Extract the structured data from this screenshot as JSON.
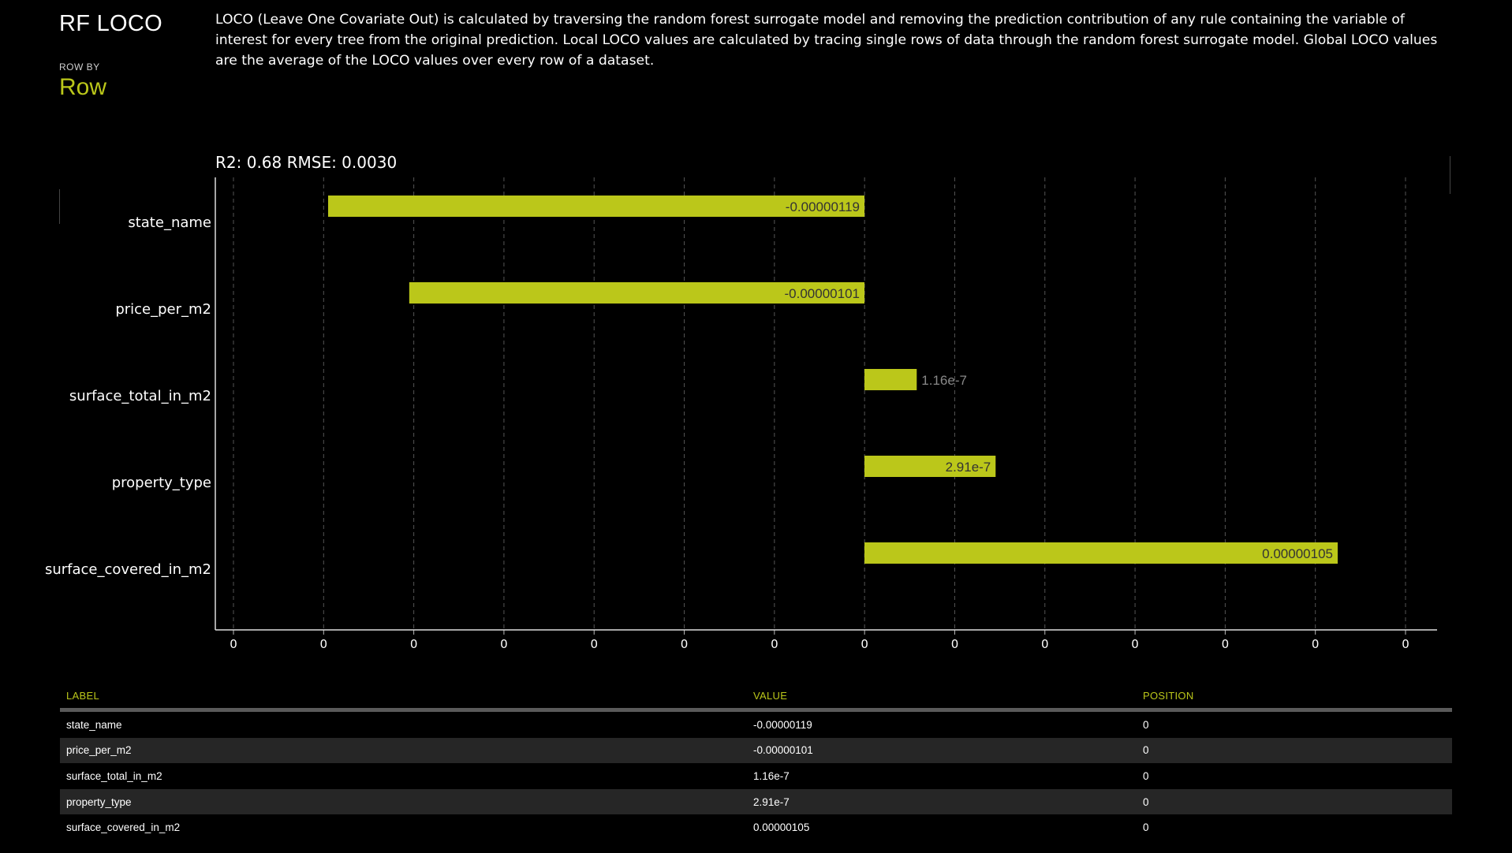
{
  "header": {
    "title": "RF LOCO",
    "row_by_label": "ROW BY",
    "row_by_value": "Row",
    "description": "LOCO (Leave One Covariate Out) is calculated by traversing the random forest surrogate model and removing the prediction contribution of any rule containing the variable of interest for every tree from the original prediction. Local LOCO values are calculated by tracing single rows of data through the random forest surrogate model. Global LOCO values are the average of the LOCO values over every row of a dataset."
  },
  "fit_stats": "R2: 0.68 RMSE: 0.0030",
  "colors": {
    "bar": "#bbc71a",
    "accent": "#bbc71a",
    "grid": "#555555",
    "background": "#000000"
  },
  "chart_data": {
    "type": "bar",
    "orientation": "horizontal",
    "categories": [
      "state_name",
      "price_per_m2",
      "surface_total_in_m2",
      "property_type",
      "surface_covered_in_m2"
    ],
    "values": [
      -1.19e-06,
      -1.01e-06,
      1.16e-07,
      2.91e-07,
      1.05e-06
    ],
    "value_labels": [
      "-0.00000119",
      "-0.00000101",
      "1.16e-7",
      "2.91e-7",
      "0.00000105"
    ],
    "x_tick_labels": [
      "0",
      "0",
      "0",
      "0",
      "0",
      "0",
      "0",
      "0",
      "0",
      "0",
      "0",
      "0",
      "0",
      "0"
    ],
    "xlim": [
      -1.4e-06,
      1.2e-06
    ],
    "grid": true
  },
  "table": {
    "headers": [
      "LABEL",
      "VALUE",
      "POSITION"
    ],
    "rows": [
      [
        "state_name",
        "-0.00000119",
        "0"
      ],
      [
        "price_per_m2",
        "-0.00000101",
        "0"
      ],
      [
        "surface_total_in_m2",
        "1.16e-7",
        "0"
      ],
      [
        "property_type",
        "2.91e-7",
        "0"
      ],
      [
        "surface_covered_in_m2",
        "0.00000105",
        "0"
      ]
    ]
  }
}
